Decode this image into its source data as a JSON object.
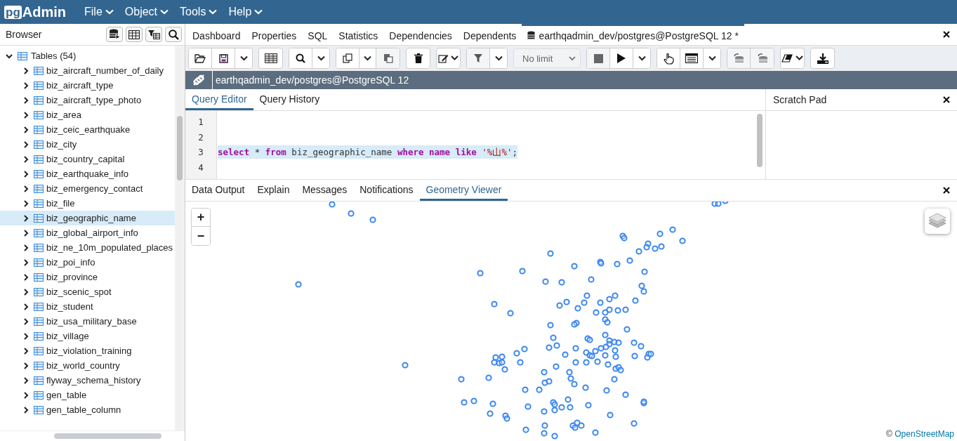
{
  "app": {
    "logo_badge": "pg",
    "logo_text": "Admin",
    "menus": [
      {
        "label": "File"
      },
      {
        "label": "Object"
      },
      {
        "label": "Tools"
      },
      {
        "label": "Help"
      }
    ]
  },
  "browser": {
    "title": "Browser",
    "tree": [
      {
        "label": "Tables (54)",
        "kind": "folder",
        "expanded": true,
        "selected": false,
        "children": [
          {
            "label": "biz_aircraft_number_of_daily",
            "kind": "table",
            "expanded": false,
            "selected": false
          },
          {
            "label": "biz_aircraft_type",
            "kind": "table",
            "expanded": false,
            "selected": false
          },
          {
            "label": "biz_aircraft_type_photo",
            "kind": "table",
            "expanded": false,
            "selected": false
          },
          {
            "label": "biz_area",
            "kind": "table",
            "expanded": false,
            "selected": false
          },
          {
            "label": "biz_ceic_earthquake",
            "kind": "table",
            "expanded": false,
            "selected": false
          },
          {
            "label": "biz_city",
            "kind": "table",
            "expanded": false,
            "selected": false
          },
          {
            "label": "biz_country_capital",
            "kind": "table",
            "expanded": false,
            "selected": false
          },
          {
            "label": "biz_earthquake_info",
            "kind": "table",
            "expanded": false,
            "selected": false
          },
          {
            "label": "biz_emergency_contact",
            "kind": "table",
            "expanded": false,
            "selected": false
          },
          {
            "label": "biz_file",
            "kind": "table",
            "expanded": false,
            "selected": false
          },
          {
            "label": "biz_geographic_name",
            "kind": "table",
            "expanded": false,
            "selected": true
          },
          {
            "label": "biz_global_airport_info",
            "kind": "table",
            "expanded": false,
            "selected": false
          },
          {
            "label": "biz_ne_10m_populated_places",
            "kind": "table",
            "expanded": false,
            "selected": false
          },
          {
            "label": "biz_poi_info",
            "kind": "table",
            "expanded": false,
            "selected": false
          },
          {
            "label": "biz_province",
            "kind": "table",
            "expanded": false,
            "selected": false
          },
          {
            "label": "biz_scenic_spot",
            "kind": "table",
            "expanded": false,
            "selected": false
          },
          {
            "label": "biz_student",
            "kind": "table",
            "expanded": false,
            "selected": false
          },
          {
            "label": "biz_usa_military_base",
            "kind": "table",
            "expanded": false,
            "selected": false
          },
          {
            "label": "biz_village",
            "kind": "table",
            "expanded": false,
            "selected": false
          },
          {
            "label": "biz_violation_training",
            "kind": "table",
            "expanded": false,
            "selected": false
          },
          {
            "label": "biz_world_country",
            "kind": "table",
            "expanded": false,
            "selected": false
          },
          {
            "label": "flyway_schema_history",
            "kind": "table",
            "expanded": false,
            "selected": false
          },
          {
            "label": "gen_table",
            "kind": "table",
            "expanded": false,
            "selected": false
          },
          {
            "label": "gen_table_column",
            "kind": "table",
            "expanded": false,
            "selected": false
          }
        ]
      }
    ]
  },
  "tabs": [
    {
      "label": "Dashboard",
      "kind": "panel",
      "selected": false
    },
    {
      "label": "Properties",
      "kind": "panel",
      "selected": false
    },
    {
      "label": "SQL",
      "kind": "panel",
      "selected": false
    },
    {
      "label": "Statistics",
      "kind": "panel",
      "selected": false
    },
    {
      "label": "Dependencies",
      "kind": "panel",
      "selected": false
    },
    {
      "label": "Dependents",
      "kind": "panel",
      "selected": false
    },
    {
      "label": "earthqadmin_dev/postgres@PostgreSQL 12 *",
      "kind": "query",
      "selected": true
    }
  ],
  "toolbar": {
    "row_limit": "No limit"
  },
  "connection": {
    "label": "earthqadmin_dev/postgres@PostgreSQL 12"
  },
  "editor_tabs": [
    {
      "label": "Query Editor",
      "selected": true
    },
    {
      "label": "Query History",
      "selected": false
    }
  ],
  "editor": {
    "lines": [
      {
        "number": "1"
      },
      {
        "number": "2"
      },
      {
        "number": "3",
        "selected": true,
        "tokens": [
          {
            "text": "select",
            "kind": "keyword"
          },
          {
            "text": " * ",
            "kind": "plain"
          },
          {
            "text": "from",
            "kind": "keyword"
          },
          {
            "text": " biz_geographic_name ",
            "kind": "plain"
          },
          {
            "text": "where ",
            "kind": "keyword"
          },
          {
            "text": "name ",
            "kind": "keyword"
          },
          {
            "text": "like ",
            "kind": "keyword"
          },
          {
            "text": "'%山%'",
            "kind": "string"
          },
          {
            "text": ";",
            "kind": "plain"
          }
        ]
      },
      {
        "number": "4"
      }
    ]
  },
  "scratch_pad": {
    "title": "Scratch Pad"
  },
  "result_tabs": [
    {
      "label": "Data Output",
      "selected": false
    },
    {
      "label": "Explain",
      "selected": false
    },
    {
      "label": "Messages",
      "selected": false
    },
    {
      "label": "Notifications",
      "selected": false
    },
    {
      "label": "Geometry Viewer",
      "selected": true
    }
  ],
  "map": {
    "zoom_in": "+",
    "zoom_out": "−",
    "attribution_mark": "©",
    "attribution_link": "OpenStreetMap"
  }
}
